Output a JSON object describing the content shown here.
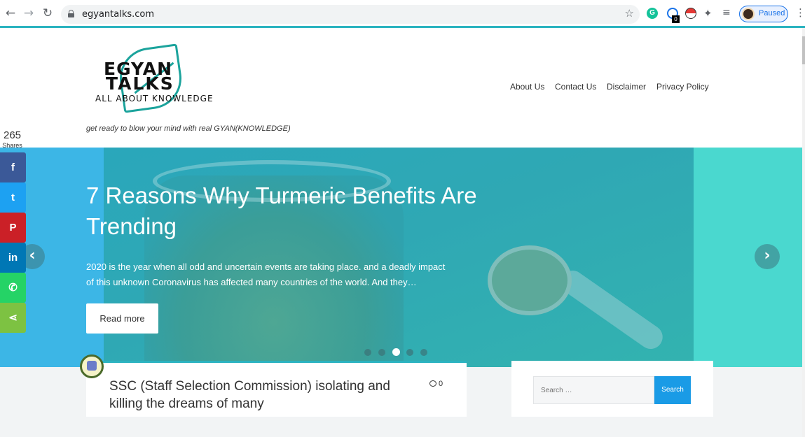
{
  "browser": {
    "url": "egyantalks.com",
    "profile_status": "Paused",
    "extension_badge": "0",
    "icons": {
      "back": "arrow-left-icon",
      "forward": "arrow-right-icon",
      "reload": "reload-icon",
      "bookmark": "star-icon",
      "menu": "kebab-menu-icon"
    },
    "accent": "#1a73e8"
  },
  "site": {
    "logo_line1": "EGYAN",
    "logo_line2": "TALKS",
    "logo_line3": "ALL ABOUT KNOWLEDGE",
    "tagline": "get ready to blow your mind with real GYAN(KNOWLEDGE)",
    "nav": [
      "About Us",
      "Contact Us",
      "Disclaimer",
      "Privacy Policy"
    ],
    "accent_color": "#2bb3c0"
  },
  "hero": {
    "title": "7 Reasons Why Turmeric Benefits Are Trending",
    "excerpt": "2020 is the year when all odd and uncertain events are taking place. and a deadly impact of this unknown Coronavirus has affected many countries of the world. And they…",
    "button": "Read more",
    "prev": "‹",
    "next": "›",
    "slide_count": 5,
    "active_slide": 3
  },
  "share": {
    "count": "265",
    "label": "Shares",
    "buttons": [
      {
        "network": "facebook",
        "glyph": "f",
        "color": "#3b5998"
      },
      {
        "network": "twitter",
        "glyph": "t",
        "color": "#1da1f2"
      },
      {
        "network": "pinterest",
        "glyph": "P",
        "color": "#cb2027"
      },
      {
        "network": "linkedin",
        "glyph": "in",
        "color": "#0077b5"
      },
      {
        "network": "whatsapp",
        "glyph": "✆",
        "color": "#25d366"
      },
      {
        "network": "share",
        "glyph": "⋖",
        "color": "#7dc242"
      }
    ]
  },
  "post": {
    "title": "SSC (Staff Selection Commission) isolating and killing the dreams of many",
    "comments": "0"
  },
  "sidebar": {
    "search_placeholder": "Search …",
    "search_button": "Search"
  }
}
